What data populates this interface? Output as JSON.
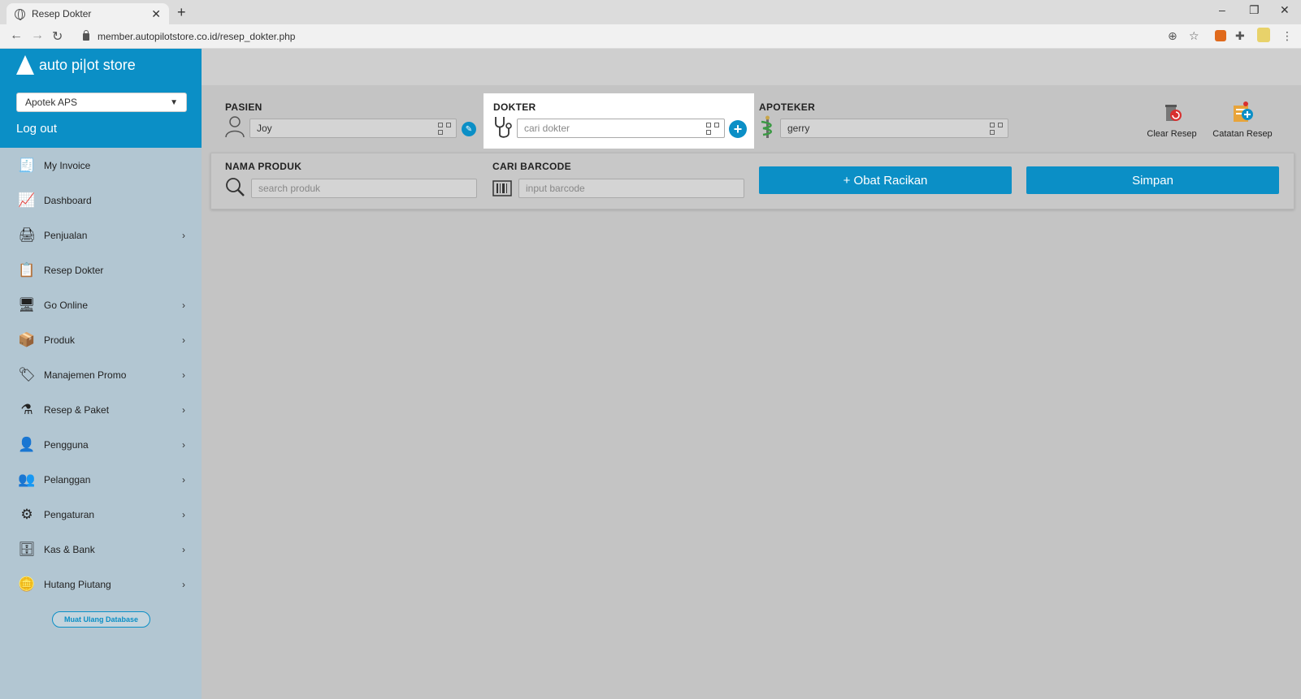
{
  "browser": {
    "tab_title": "Resep Dokter",
    "tab_close": "✕",
    "new_tab": "+",
    "url": "member.autopilotstore.co.id/resep_dokter.php",
    "minimize": "–",
    "restore": "❐",
    "close": "✕"
  },
  "sidebar": {
    "brand": "auto pi|ot store",
    "store_selected": "Apotek APS",
    "logout": "Log out",
    "items": [
      {
        "label": "My Invoice",
        "icon": "invoice-icon",
        "arrow": ""
      },
      {
        "label": "Dashboard",
        "icon": "chart-icon",
        "arrow": ""
      },
      {
        "label": "Penjualan",
        "icon": "cash-register-icon",
        "arrow": "›"
      },
      {
        "label": "Resep Dokter",
        "icon": "prescription-icon",
        "arrow": ""
      },
      {
        "label": "Go Online",
        "icon": "monitor-icon",
        "arrow": "›"
      },
      {
        "label": "Produk",
        "icon": "box-icon",
        "arrow": "›"
      },
      {
        "label": "Manajemen Promo",
        "icon": "tag-icon",
        "arrow": "›"
      },
      {
        "label": "Resep & Paket",
        "icon": "mortar-icon",
        "arrow": "›"
      },
      {
        "label": "Pengguna",
        "icon": "user-icon",
        "arrow": "›"
      },
      {
        "label": "Pelanggan",
        "icon": "customer-icon",
        "arrow": "›"
      },
      {
        "label": "Pengaturan",
        "icon": "gears-icon",
        "arrow": "›"
      },
      {
        "label": "Kas & Bank",
        "icon": "safe-icon",
        "arrow": "›"
      },
      {
        "label": "Hutang Piutang",
        "icon": "coins-hand-icon",
        "arrow": "›"
      }
    ],
    "reload_button": "Muat Ulang Database"
  },
  "form": {
    "pasien_label": "PASIEN",
    "pasien_value": "Joy",
    "dokter_label": "DOKTER",
    "dokter_placeholder": "cari dokter",
    "apoteker_label": "APOTEKER",
    "apoteker_value": "gerry",
    "nama_produk_label": "NAMA PRODUK",
    "nama_produk_placeholder": "search produk",
    "barcode_label": "CARI BARCODE",
    "barcode_placeholder": "input barcode",
    "obat_racikan_button": "+ Obat Racikan",
    "simpan_button": "Simpan"
  },
  "tools": {
    "clear_resep": "Clear Resep",
    "catatan_resep": "Catatan Resep"
  },
  "colors": {
    "primary": "#0b8fc6",
    "sidebar_bg": "#b2c6d2",
    "content_bg": "#c4c4c4"
  }
}
